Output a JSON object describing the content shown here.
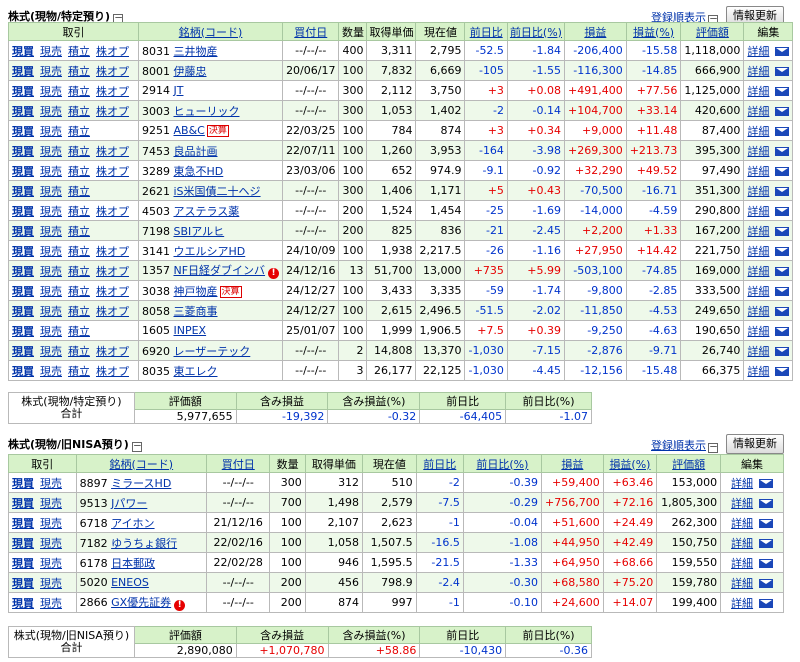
{
  "labels": {
    "buy": "現買",
    "sell": "現売",
    "accum": "積立",
    "opt": "株オプ",
    "detail": "詳細",
    "toggle": "－"
  },
  "columns": [
    "取引",
    "銘柄(コード)",
    "買付日",
    "数量",
    "取得単価",
    "現在値",
    "前日比",
    "前日比(%)",
    "損益",
    "損益(%)",
    "評価額",
    "編集"
  ],
  "summary_columns": [
    "評価額",
    "含み損益",
    "含み損益(%)",
    "前日比",
    "前日比(%)"
  ],
  "sections": [
    {
      "title": "株式(現物/特定預り)",
      "sort_link": "登録順表示",
      "refresh": "情報更新",
      "rows": [
        {
          "acts": [
            "buy",
            "sell",
            "accum",
            "opt"
          ],
          "code": "8031",
          "name": "三井物産",
          "date": "--/--/--",
          "qty": "400",
          "cost": "3,311",
          "price": "2,795",
          "chg": "-52.5",
          "chgp": "-1.84",
          "pl": "-206,400",
          "plp": "-15.58",
          "val": "1,118,000"
        },
        {
          "acts": [
            "buy",
            "sell",
            "accum",
            "opt"
          ],
          "code": "8001",
          "name": "伊藤忠",
          "date": "20/06/17",
          "qty": "100",
          "cost": "7,832",
          "price": "6,669",
          "chg": "-105",
          "chgp": "-1.55",
          "pl": "-116,300",
          "plp": "-14.85",
          "val": "666,900"
        },
        {
          "acts": [
            "buy",
            "sell",
            "accum",
            "opt"
          ],
          "code": "2914",
          "name": "JT",
          "date": "--/--/--",
          "qty": "300",
          "cost": "2,112",
          "price": "3,750",
          "chg": "+3",
          "chgp": "+0.08",
          "pl": "+491,400",
          "plp": "+77.56",
          "val": "1,125,000"
        },
        {
          "acts": [
            "buy",
            "sell",
            "accum",
            "opt"
          ],
          "code": "3003",
          "name": "ヒューリック",
          "date": "--/--/--",
          "qty": "300",
          "cost": "1,053",
          "price": "1,402",
          "chg": "-2",
          "chgp": "-0.14",
          "pl": "+104,700",
          "plp": "+33.14",
          "val": "420,600"
        },
        {
          "acts": [
            "buy",
            "sell",
            "accum"
          ],
          "code": "9251",
          "name": "AB&C",
          "badge": "決算",
          "date": "22/03/25",
          "qty": "100",
          "cost": "784",
          "price": "874",
          "chg": "+3",
          "chgp": "+0.34",
          "pl": "+9,000",
          "plp": "+11.48",
          "val": "87,400"
        },
        {
          "acts": [
            "buy",
            "sell",
            "accum",
            "opt"
          ],
          "code": "7453",
          "name": "良品計画",
          "date": "22/07/11",
          "qty": "100",
          "cost": "1,260",
          "price": "3,953",
          "chg": "-164",
          "chgp": "-3.98",
          "pl": "+269,300",
          "plp": "+213.73",
          "val": "395,300"
        },
        {
          "acts": [
            "buy",
            "sell",
            "accum",
            "opt"
          ],
          "code": "3289",
          "name": "東急不HD",
          "date": "23/03/06",
          "qty": "100",
          "cost": "652",
          "price": "974.9",
          "chg": "-9.1",
          "chgp": "-0.92",
          "pl": "+32,290",
          "plp": "+49.52",
          "val": "97,490"
        },
        {
          "acts": [
            "buy",
            "sell",
            "accum"
          ],
          "code": "2621",
          "name": "iS米国債二十ヘジ",
          "date": "--/--/--",
          "qty": "300",
          "cost": "1,406",
          "price": "1,171",
          "chg": "+5",
          "chgp": "+0.43",
          "pl": "-70,500",
          "plp": "-16.71",
          "val": "351,300"
        },
        {
          "acts": [
            "buy",
            "sell",
            "accum",
            "opt"
          ],
          "code": "4503",
          "name": "アステラス薬",
          "date": "--/--/--",
          "qty": "200",
          "cost": "1,524",
          "price": "1,454",
          "chg": "-25",
          "chgp": "-1.69",
          "pl": "-14,000",
          "plp": "-4.59",
          "val": "290,800"
        },
        {
          "acts": [
            "buy",
            "sell",
            "accum"
          ],
          "code": "7198",
          "name": "SBIアルヒ",
          "date": "--/--/--",
          "qty": "200",
          "cost": "825",
          "price": "836",
          "chg": "-21",
          "chgp": "-2.45",
          "pl": "+2,200",
          "plp": "+1.33",
          "val": "167,200"
        },
        {
          "acts": [
            "buy",
            "sell",
            "accum",
            "opt"
          ],
          "code": "3141",
          "name": "ウエルシアHD",
          "date": "24/10/09",
          "qty": "100",
          "cost": "1,938",
          "price": "2,217.5",
          "chg": "-26",
          "chgp": "-1.16",
          "pl": "+27,950",
          "plp": "+14.42",
          "val": "221,750"
        },
        {
          "acts": [
            "buy",
            "sell",
            "accum",
            "opt"
          ],
          "code": "1357",
          "name": "NF日経ダブインバ",
          "warn": "!",
          "date": "24/12/16",
          "qty": "13",
          "cost": "51,700",
          "price": "13,000",
          "chg": "+735",
          "chgp": "+5.99",
          "pl": "-503,100",
          "plp": "-74.85",
          "val": "169,000"
        },
        {
          "acts": [
            "buy",
            "sell",
            "accum",
            "opt"
          ],
          "code": "3038",
          "name": "神戸物産",
          "badge": "決算",
          "date": "24/12/27",
          "qty": "100",
          "cost": "3,433",
          "price": "3,335",
          "chg": "-59",
          "chgp": "-1.74",
          "pl": "-9,800",
          "plp": "-2.85",
          "val": "333,500"
        },
        {
          "acts": [
            "buy",
            "sell",
            "accum",
            "opt"
          ],
          "code": "8058",
          "name": "三菱商事",
          "date": "24/12/27",
          "qty": "100",
          "cost": "2,615",
          "price": "2,496.5",
          "chg": "-51.5",
          "chgp": "-2.02",
          "pl": "-11,850",
          "plp": "-4.53",
          "val": "249,650"
        },
        {
          "acts": [
            "buy",
            "sell",
            "accum"
          ],
          "code": "1605",
          "name": "INPEX",
          "date": "25/01/07",
          "qty": "100",
          "cost": "1,999",
          "price": "1,906.5",
          "chg": "+7.5",
          "chgp": "+0.39",
          "pl": "-9,250",
          "plp": "-4.63",
          "val": "190,650"
        },
        {
          "acts": [
            "buy",
            "sell",
            "accum",
            "opt"
          ],
          "code": "6920",
          "name": "レーザーテック",
          "date": "--/--/--",
          "qty": "2",
          "cost": "14,808",
          "price": "13,370",
          "chg": "-1,030",
          "chgp": "-7.15",
          "pl": "-2,876",
          "plp": "-9.71",
          "val": "26,740"
        },
        {
          "acts": [
            "buy",
            "sell",
            "accum",
            "opt"
          ],
          "code": "8035",
          "name": "東エレク",
          "date": "--/--/--",
          "qty": "3",
          "cost": "26,177",
          "price": "22,125",
          "chg": "-1,030",
          "chgp": "-4.45",
          "pl": "-12,156",
          "plp": "-15.48",
          "val": "66,375"
        }
      ],
      "summary": {
        "label1": "株式(現物/特定預り)",
        "label2": "合計",
        "val": "5,977,655",
        "pl": "-19,392",
        "plp": "-0.32",
        "chg": "-64,405",
        "chgp": "-1.07"
      }
    },
    {
      "title": "株式(現物/旧NISA預り)",
      "sort_link": "登録順表示",
      "refresh": "情報更新",
      "rows": [
        {
          "acts": [
            "buy",
            "sell"
          ],
          "code": "8897",
          "name": "ミラースHD",
          "date": "--/--/--",
          "qty": "300",
          "cost": "312",
          "price": "510",
          "chg": "-2",
          "chgp": "-0.39",
          "pl": "+59,400",
          "plp": "+63.46",
          "val": "153,000"
        },
        {
          "acts": [
            "buy",
            "sell"
          ],
          "code": "9513",
          "name": "Jパワー",
          "date": "--/--/--",
          "qty": "700",
          "cost": "1,498",
          "price": "2,579",
          "chg": "-7.5",
          "chgp": "-0.29",
          "pl": "+756,700",
          "plp": "+72.16",
          "val": "1,805,300"
        },
        {
          "acts": [
            "buy",
            "sell"
          ],
          "code": "6718",
          "name": "アイホン",
          "date": "21/12/16",
          "qty": "100",
          "cost": "2,107",
          "price": "2,623",
          "chg": "-1",
          "chgp": "-0.04",
          "pl": "+51,600",
          "plp": "+24.49",
          "val": "262,300"
        },
        {
          "acts": [
            "buy",
            "sell"
          ],
          "code": "7182",
          "name": "ゆうちょ銀行",
          "date": "22/02/16",
          "qty": "100",
          "cost": "1,058",
          "price": "1,507.5",
          "chg": "-16.5",
          "chgp": "-1.08",
          "pl": "+44,950",
          "plp": "+42.49",
          "val": "150,750"
        },
        {
          "acts": [
            "buy",
            "sell"
          ],
          "code": "6178",
          "name": "日本郵政",
          "date": "22/02/28",
          "qty": "100",
          "cost": "946",
          "price": "1,595.5",
          "chg": "-21.5",
          "chgp": "-1.33",
          "pl": "+64,950",
          "plp": "+68.66",
          "val": "159,550"
        },
        {
          "acts": [
            "buy",
            "sell"
          ],
          "code": "5020",
          "name": "ENEOS",
          "date": "--/--/--",
          "qty": "200",
          "cost": "456",
          "price": "798.9",
          "chg": "-2.4",
          "chgp": "-0.30",
          "pl": "+68,580",
          "plp": "+75.20",
          "val": "159,780"
        },
        {
          "acts": [
            "buy",
            "sell"
          ],
          "code": "2866",
          "name": "GX優先証券",
          "warn": "!",
          "date": "--/--/--",
          "qty": "200",
          "cost": "874",
          "price": "997",
          "chg": "-1",
          "chgp": "-0.10",
          "pl": "+24,600",
          "plp": "+14.07",
          "val": "199,400"
        }
      ],
      "summary": {
        "label1": "株式(現物/旧NISA預り)",
        "label2": "合計",
        "val": "2,890,080",
        "pl": "+1,070,780",
        "plp": "+58.86",
        "chg": "-10,430",
        "chgp": "-0.36"
      }
    }
  ]
}
